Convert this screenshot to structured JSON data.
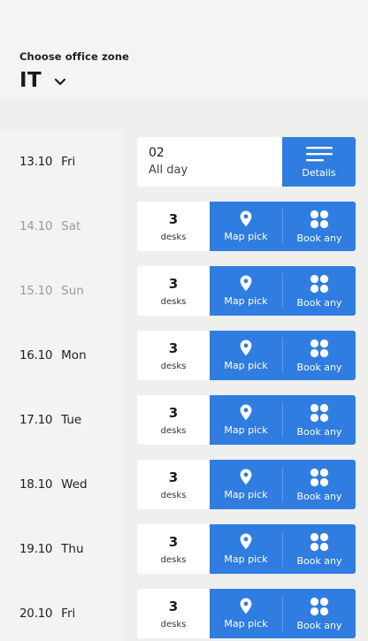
{
  "header": {
    "zone_label": "Choose office zone",
    "zone_value": "IT"
  },
  "first_day": {
    "date": "13.10",
    "day": "Fri",
    "booking_number": "02",
    "booking_time": "All day",
    "details_label": "Details"
  },
  "days": [
    {
      "date": "14.10",
      "day": "Sat",
      "muted": true,
      "count": "3",
      "count_label": "desks",
      "map_label": "Map pick",
      "book_label": "Book any"
    },
    {
      "date": "15.10",
      "day": "Sun",
      "muted": true,
      "count": "3",
      "count_label": "desks",
      "map_label": "Map pick",
      "book_label": "Book any"
    },
    {
      "date": "16.10",
      "day": "Mon",
      "muted": false,
      "count": "3",
      "count_label": "desks",
      "map_label": "Map pick",
      "book_label": "Book any"
    },
    {
      "date": "17.10",
      "day": "Tue",
      "muted": false,
      "count": "3",
      "count_label": "desks",
      "map_label": "Map pick",
      "book_label": "Book any"
    },
    {
      "date": "18.10",
      "day": "Wed",
      "muted": false,
      "count": "3",
      "count_label": "desks",
      "map_label": "Map pick",
      "book_label": "Book any"
    },
    {
      "date": "19.10",
      "day": "Thu",
      "muted": false,
      "count": "3",
      "count_label": "desks",
      "map_label": "Map pick",
      "book_label": "Book any"
    },
    {
      "date": "20.10",
      "day": "Fri",
      "muted": false,
      "count": "3",
      "count_label": "desks",
      "map_label": "Map pick",
      "book_label": "Book any"
    }
  ],
  "colors": {
    "accent": "#2f7de0",
    "muted_text": "#9a9a9a"
  },
  "icons": {
    "zone_dropdown": "chevron-down-icon",
    "details": "menu-lines-icon",
    "map_pick": "map-pin-icon",
    "book_any": "four-dots-icon"
  }
}
